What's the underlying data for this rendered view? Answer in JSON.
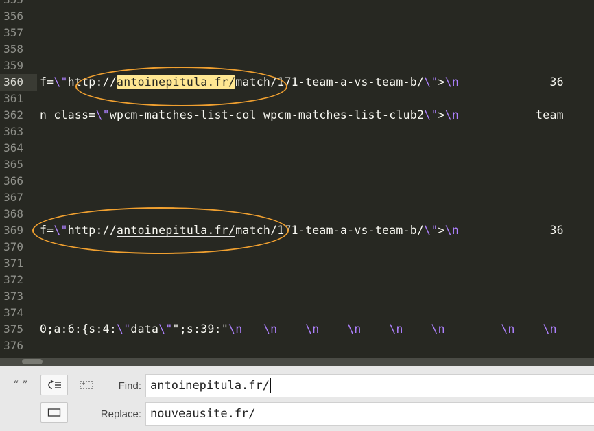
{
  "editor": {
    "partial_top_line": "355",
    "lines": [
      {
        "n": "356",
        "segs": []
      },
      {
        "n": "357",
        "segs": []
      },
      {
        "n": "358",
        "segs": []
      },
      {
        "n": "359",
        "segs": []
      },
      {
        "n": "360",
        "current": true,
        "segs": [
          {
            "t": "f=",
            "c": ""
          },
          {
            "t": "\\\"",
            "c": "esc"
          },
          {
            "t": "http://",
            "c": ""
          },
          {
            "t": "antoinepitula.fr/",
            "c": "sel"
          },
          {
            "t": "match/171-team-a-vs-team-b/",
            "c": ""
          },
          {
            "t": "\\\"",
            "c": "esc"
          },
          {
            "t": ">",
            "c": ""
          },
          {
            "t": "\\n",
            "c": "esc"
          },
          {
            "t": "             36",
            "c": ""
          }
        ]
      },
      {
        "n": "361",
        "segs": []
      },
      {
        "n": "362",
        "segs": [
          {
            "t": "n class=",
            "c": ""
          },
          {
            "t": "\\\"",
            "c": "esc"
          },
          {
            "t": "wpcm-matches-list-col wpcm-matches-list-club2",
            "c": ""
          },
          {
            "t": "\\\"",
            "c": "esc"
          },
          {
            "t": ">",
            "c": ""
          },
          {
            "t": "\\n",
            "c": "esc"
          },
          {
            "t": "           team",
            "c": ""
          }
        ]
      },
      {
        "n": "363",
        "segs": []
      },
      {
        "n": "364",
        "segs": []
      },
      {
        "n": "365",
        "segs": []
      },
      {
        "n": "366",
        "segs": []
      },
      {
        "n": "367",
        "segs": []
      },
      {
        "n": "368",
        "segs": []
      },
      {
        "n": "369",
        "segs": [
          {
            "t": "f=",
            "c": ""
          },
          {
            "t": "\\\"",
            "c": "esc"
          },
          {
            "t": "http://",
            "c": ""
          },
          {
            "t": "antoinepitula.fr/",
            "c": "box"
          },
          {
            "t": "match/171-team-a-vs-team-b/",
            "c": ""
          },
          {
            "t": "\\\"",
            "c": "esc"
          },
          {
            "t": ">",
            "c": ""
          },
          {
            "t": "\\n",
            "c": "esc"
          },
          {
            "t": "             36",
            "c": ""
          }
        ]
      },
      {
        "n": "370",
        "segs": []
      },
      {
        "n": "371",
        "segs": []
      },
      {
        "n": "372",
        "segs": []
      },
      {
        "n": "373",
        "segs": []
      },
      {
        "n": "374",
        "segs": []
      },
      {
        "n": "375",
        "segs": [
          {
            "t": "0;a:6:{s:4:",
            "c": ""
          },
          {
            "t": "\\\"",
            "c": "esc"
          },
          {
            "t": "data",
            "c": ""
          },
          {
            "t": "\\\"",
            "c": "esc"
          },
          {
            "t": "\";s:39:\"",
            "c": ""
          },
          {
            "t": "\\n",
            "c": "esc"
          },
          {
            "t": "   ",
            "c": ""
          },
          {
            "t": "\\n",
            "c": "esc"
          },
          {
            "t": "    ",
            "c": ""
          },
          {
            "t": "\\n",
            "c": "esc"
          },
          {
            "t": "    ",
            "c": ""
          },
          {
            "t": "\\n",
            "c": "esc"
          },
          {
            "t": "    ",
            "c": ""
          },
          {
            "t": "\\n",
            "c": "esc"
          },
          {
            "t": "    ",
            "c": ""
          },
          {
            "t": "\\n",
            "c": "esc"
          },
          {
            "t": "        ",
            "c": ""
          },
          {
            "t": "\\n",
            "c": "esc"
          },
          {
            "t": "    ",
            "c": ""
          },
          {
            "t": "\\n",
            "c": "esc"
          }
        ]
      },
      {
        "n": "376",
        "segs": []
      }
    ]
  },
  "find_panel": {
    "find_label": "Find:",
    "find_value": "antoinepitula.fr/",
    "replace_label": "Replace:",
    "replace_value": "nouveausite.fr/",
    "buttons": {
      "quote_icon": "quote-icon",
      "wrap_icon": "wrap-around-icon",
      "selection_icon": "in-selection-icon",
      "preserve_case_icon": "preserve-case-icon"
    }
  },
  "colors": {
    "editor_bg": "#272822",
    "text": "#f8f8f2",
    "escape": "#ae81ff",
    "selection_highlight": "#ffe792",
    "annotation_ellipse": "#f0a030"
  }
}
